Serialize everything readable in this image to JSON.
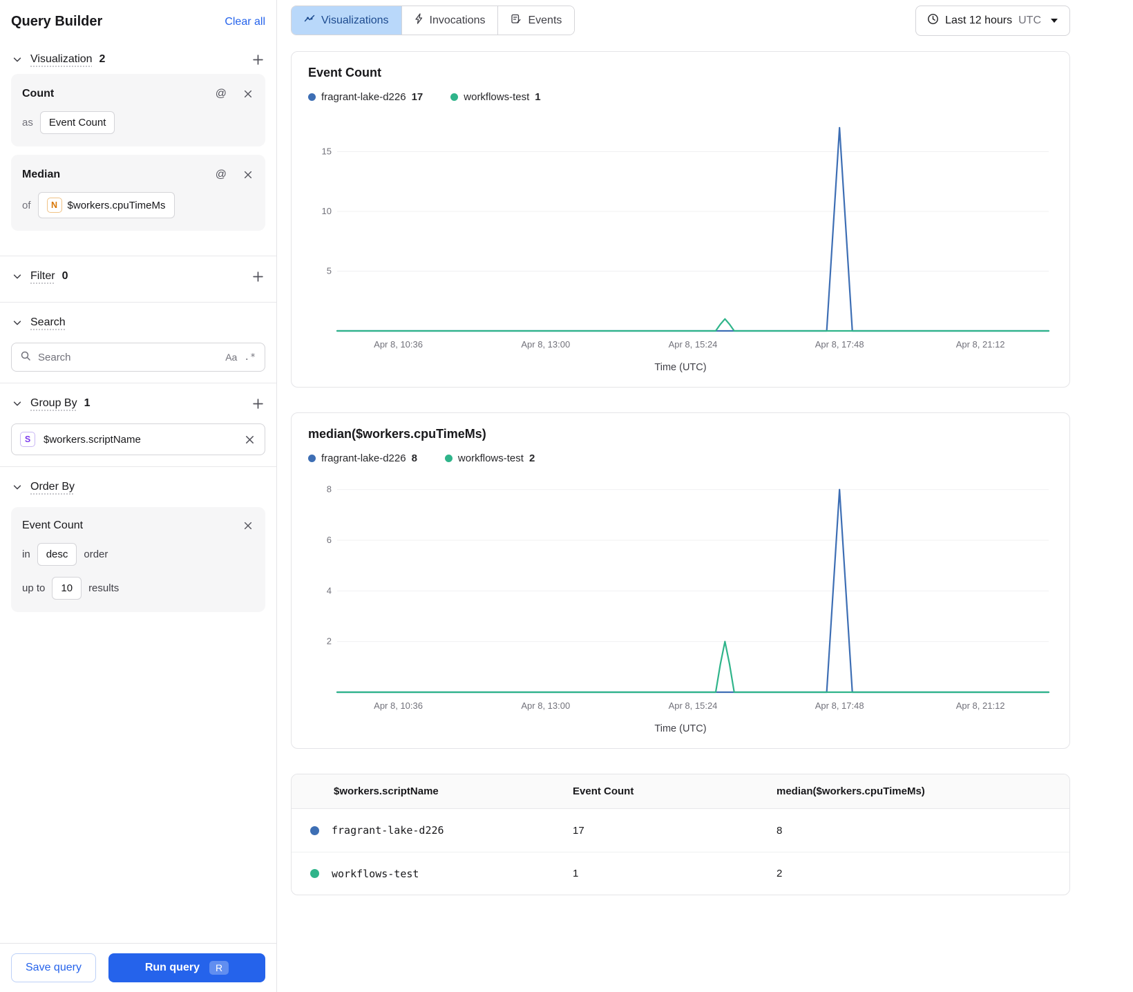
{
  "colors": {
    "accent": "#2563eb",
    "chart_blue": "#3d6eb4",
    "chart_green": "#2fb48a",
    "active_tab_bg": "#b9d8fa"
  },
  "sidebar": {
    "title": "Query Builder",
    "clear_all": "Clear all",
    "visualization": {
      "label": "Visualization",
      "count": "2"
    },
    "count_card": {
      "title": "Count",
      "as_label": "as",
      "value": "Event Count"
    },
    "median_card": {
      "title": "Median",
      "of_label": "of",
      "badge": "N",
      "value": "$workers.cpuTimeMs"
    },
    "filter": {
      "label": "Filter",
      "count": "0"
    },
    "search": {
      "label": "Search",
      "placeholder": "Search",
      "case_icon": "Aa",
      "regex_icon": ".*"
    },
    "group_by": {
      "label": "Group By",
      "count": "1",
      "item_badge": "S",
      "item": "$workers.scriptName"
    },
    "order_by": {
      "label": "Order By",
      "card_title": "Event Count",
      "in_label": "in",
      "order_value": "desc",
      "order_suffix": "order",
      "upto_label": "up to",
      "limit": "10",
      "results_label": "results"
    },
    "footer": {
      "save": "Save query",
      "run": "Run query",
      "kbd": "R"
    }
  },
  "header": {
    "tabs": [
      {
        "label": "Visualizations"
      },
      {
        "label": "Invocations"
      },
      {
        "label": "Events"
      }
    ],
    "time_range": {
      "label": "Last 12 hours",
      "tz": "UTC"
    }
  },
  "chart_data": [
    {
      "type": "line",
      "title": "Event Count",
      "xlabel": "Time (UTC)",
      "x_tick_labels": [
        "Apr 8, 10:36",
        "Apr 8, 13:00",
        "Apr 8, 15:24",
        "Apr 8, 17:48",
        "Apr 8, 21:12"
      ],
      "x_tick_fracs": [
        0.086,
        0.293,
        0.5,
        0.706,
        0.904
      ],
      "y_ticks": [
        5,
        10,
        15
      ],
      "ylim": [
        0,
        17.8
      ],
      "grid": true,
      "legend": [
        {
          "name": "fragrant-lake-d226",
          "value": "17",
          "color": "#3d6eb4"
        },
        {
          "name": "workflows-test",
          "value": "1",
          "color": "#2fb48a"
        }
      ],
      "series": [
        {
          "name": "fragrant-lake-d226",
          "color": "#3d6eb4",
          "points": [
            [
              0,
              0
            ],
            [
              0.688,
              0
            ],
            [
              0.706,
              17
            ],
            [
              0.724,
              0
            ],
            [
              1,
              0
            ]
          ]
        },
        {
          "name": "workflows-test",
          "color": "#2fb48a",
          "points": [
            [
              0,
              0
            ],
            [
              0.532,
              0
            ],
            [
              0.5385,
              0.55
            ],
            [
              0.545,
              1
            ],
            [
              0.5515,
              0.55
            ],
            [
              0.558,
              0
            ],
            [
              1,
              0
            ]
          ]
        }
      ]
    },
    {
      "type": "line",
      "title": "median($workers.cpuTimeMs)",
      "xlabel": "Time (UTC)",
      "x_tick_labels": [
        "Apr 8, 10:36",
        "Apr 8, 13:00",
        "Apr 8, 15:24",
        "Apr 8, 17:48",
        "Apr 8, 21:12"
      ],
      "x_tick_fracs": [
        0.086,
        0.293,
        0.5,
        0.706,
        0.904
      ],
      "y_ticks": [
        2,
        4,
        6,
        8
      ],
      "ylim": [
        0,
        8.4
      ],
      "grid": true,
      "legend": [
        {
          "name": "fragrant-lake-d226",
          "value": "8",
          "color": "#3d6eb4"
        },
        {
          "name": "workflows-test",
          "value": "2",
          "color": "#2fb48a"
        }
      ],
      "series": [
        {
          "name": "fragrant-lake-d226",
          "color": "#3d6eb4",
          "points": [
            [
              0,
              0
            ],
            [
              0.688,
              0
            ],
            [
              0.706,
              8
            ],
            [
              0.724,
              0
            ],
            [
              1,
              0
            ]
          ]
        },
        {
          "name": "workflows-test",
          "color": "#2fb48a",
          "points": [
            [
              0,
              0
            ],
            [
              0.532,
              0
            ],
            [
              0.5385,
              1.1
            ],
            [
              0.545,
              2
            ],
            [
              0.5515,
              1.1
            ],
            [
              0.558,
              0
            ],
            [
              1,
              0
            ]
          ]
        }
      ]
    }
  ],
  "table": {
    "headers": [
      "$workers.scriptName",
      "Event Count",
      "median($workers.cpuTimeMs)"
    ],
    "rows": [
      {
        "name": "fragrant-lake-d226",
        "event_count": "17",
        "median": "8",
        "color": "#3d6eb4"
      },
      {
        "name": "workflows-test",
        "event_count": "1",
        "median": "2",
        "color": "#2fb48a"
      }
    ]
  }
}
